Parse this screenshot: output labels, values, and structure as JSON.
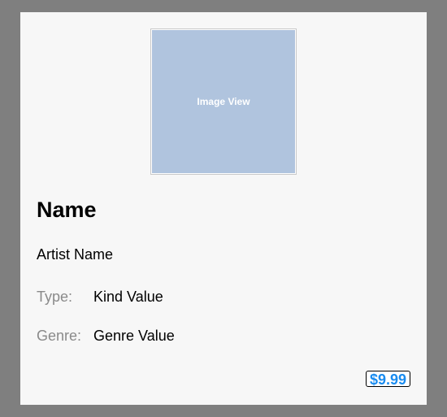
{
  "image_view": {
    "label": "Image View",
    "background_color": "#b0c4de"
  },
  "detail": {
    "name": "Name",
    "artist": "Artist Name",
    "type_label": "Type:",
    "type_value": "Kind Value",
    "genre_label": "Genre:",
    "genre_value": "Genre Value",
    "price": "$9.99"
  },
  "colors": {
    "window_background": "#7f7f7f",
    "panel_background": "#f7f7f7",
    "price_accent": "#1a8cf0",
    "secondary_text": "#8a8a8a"
  }
}
